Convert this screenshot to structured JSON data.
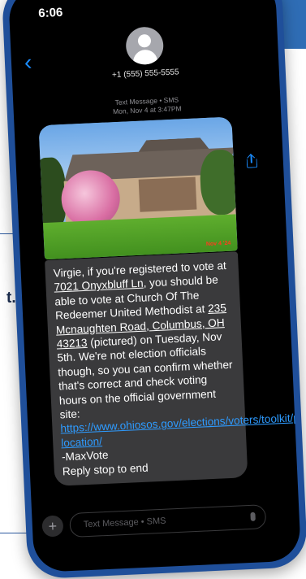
{
  "status": {
    "time": "6:06"
  },
  "contact": {
    "phone": "+1 (555) 555-5555"
  },
  "thread": {
    "service": "Text Message • SMS",
    "timestamp": "Mon, Nov 4 at 3:47PM"
  },
  "photo": {
    "date_stamp": "Nov 4 '24"
  },
  "message": {
    "t1": "Virgie, if you're registered to vote at ",
    "address": "7021 Onyxbluff Ln",
    "t2": ", you should be able to vote at Church Of The Redeemer United Methodist at ",
    "location": "235 Mcnaughten Road, Columbus, OH 43213",
    "t3": " (pictured) on Tuesday, Nov 5th. We're not election officials though, so you can confirm whether that's correct and check voting hours on the official government site: ",
    "link": "https://www.ohiosos.gov/elections/voters/toolkit/polling-location/",
    "signature": "-MaxVote",
    "optout": "Reply stop to end"
  },
  "composer": {
    "placeholder": "Text Message • SMS"
  },
  "backdrop": {
    "side_text": "t."
  },
  "icons": {
    "back": "chevron-left-icon",
    "avatar": "person-icon",
    "share": "share-icon",
    "add": "plus-icon",
    "mic": "microphone-icon"
  },
  "colors": {
    "phone_frame": "#1f4f9a",
    "accent": "#1a8cff",
    "bubble": "#3a3a3c",
    "link": "#2e9bff"
  }
}
